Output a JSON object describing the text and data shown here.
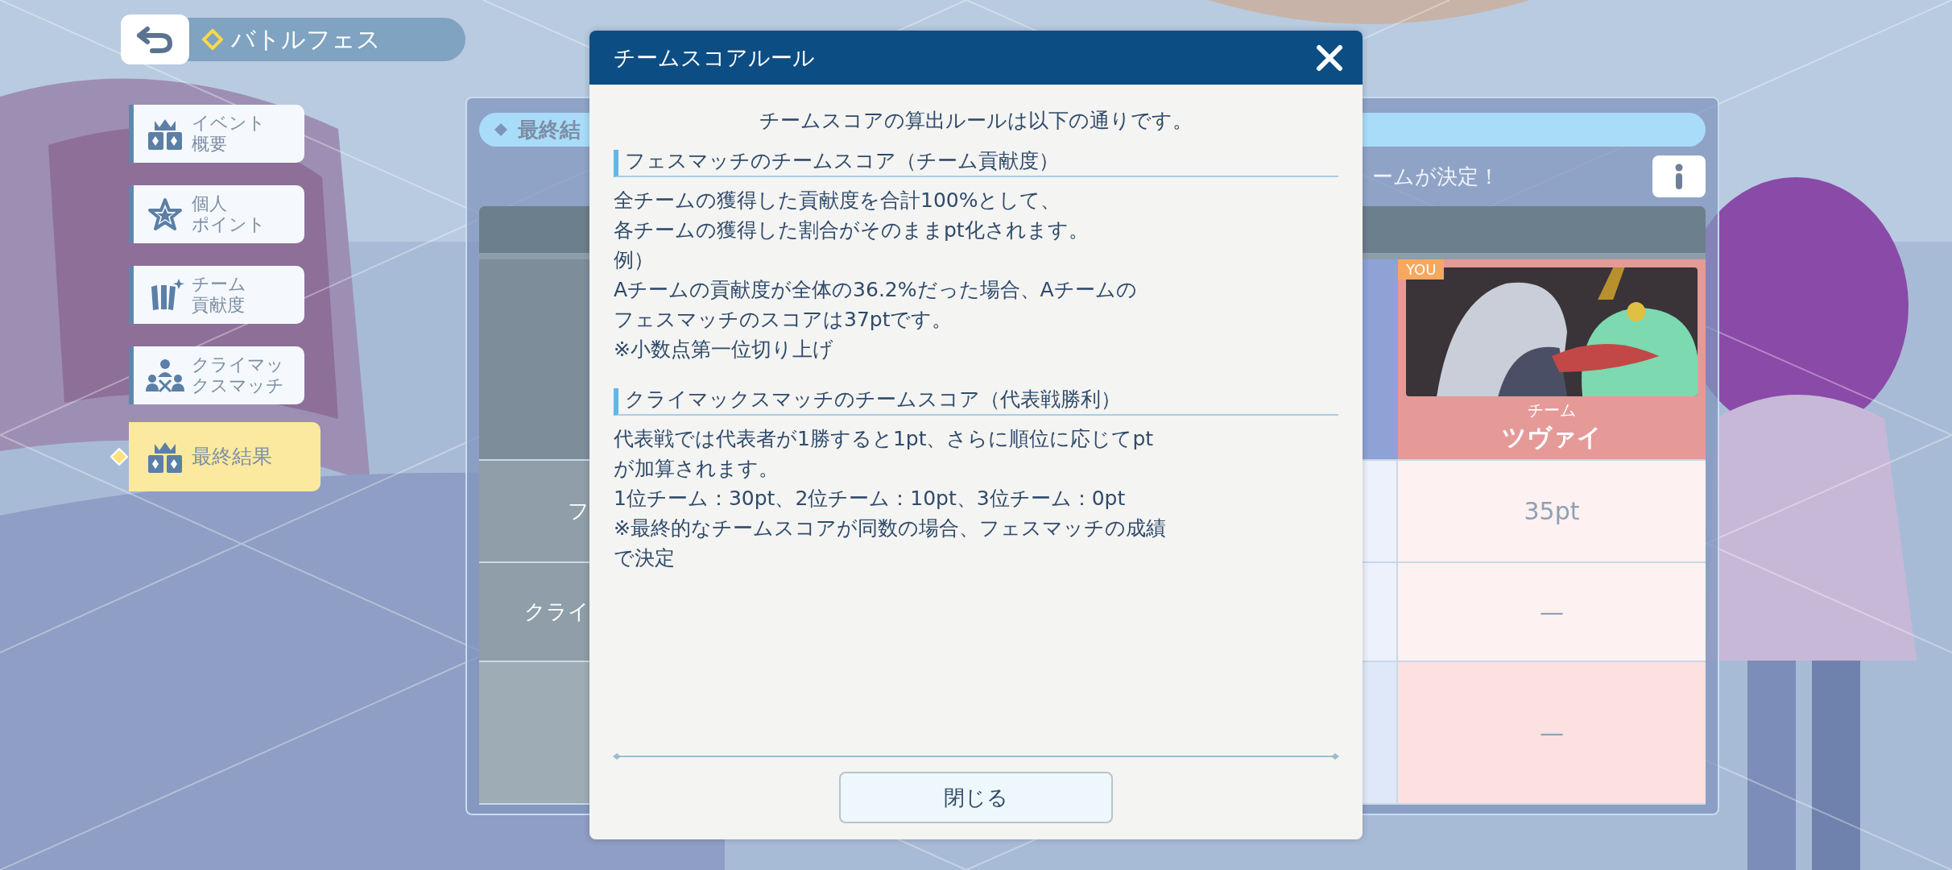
{
  "header": {
    "title": "バトルフェス"
  },
  "nav_items": [
    {
      "kind": "event",
      "lines": [
        "イベント",
        "概要"
      ],
      "selected": false
    },
    {
      "kind": "points",
      "lines": [
        "個人",
        "ポイント"
      ],
      "selected": false
    },
    {
      "kind": "contribution",
      "lines": [
        "チーム",
        "貢献度"
      ],
      "selected": false
    },
    {
      "kind": "climax",
      "lines": [
        "クライマッ",
        "クスマッチ"
      ],
      "selected": false
    },
    {
      "kind": "result",
      "lines": [
        "最終結果"
      ],
      "selected": true
    }
  ],
  "panel": {
    "tag": "最終結",
    "subtitle": "ームが決定！",
    "row_labels": [
      "フ",
      "クライ"
    ],
    "team": {
      "badge": "YOU",
      "caption": "チーム",
      "name": "ツヴァイ",
      "cells": [
        "35pt",
        "—",
        "—"
      ]
    }
  },
  "modal": {
    "title": "チームスコアルール",
    "intro": "チームスコアの算出ルールは以下の通りです。",
    "sections": [
      {
        "heading": "フェスマッチのチームスコア（チーム貢献度）",
        "lines": [
          "全チームの獲得した貢献度を合計100%として、",
          "各チームの獲得した割合がそのままpt化されます。",
          "例）",
          "Aチームの貢献度が全体の36.2%だった場合、Aチームの",
          "フェスマッチのスコアは37ptです。",
          "※小数点第一位切り上げ"
        ]
      },
      {
        "heading": "クライマックスマッチのチームスコア（代表戦勝利）",
        "lines": [
          "代表戦では代表者が1勝すると1pt、さらに順位に応じてpt",
          "が加算されます。",
          "1位チーム：30pt、2位チーム：10pt、3位チーム：0pt",
          "※最終的なチームスコアが同数の場合、フェスマッチの成績",
          "で決定"
        ]
      }
    ],
    "button": "閉じる"
  }
}
